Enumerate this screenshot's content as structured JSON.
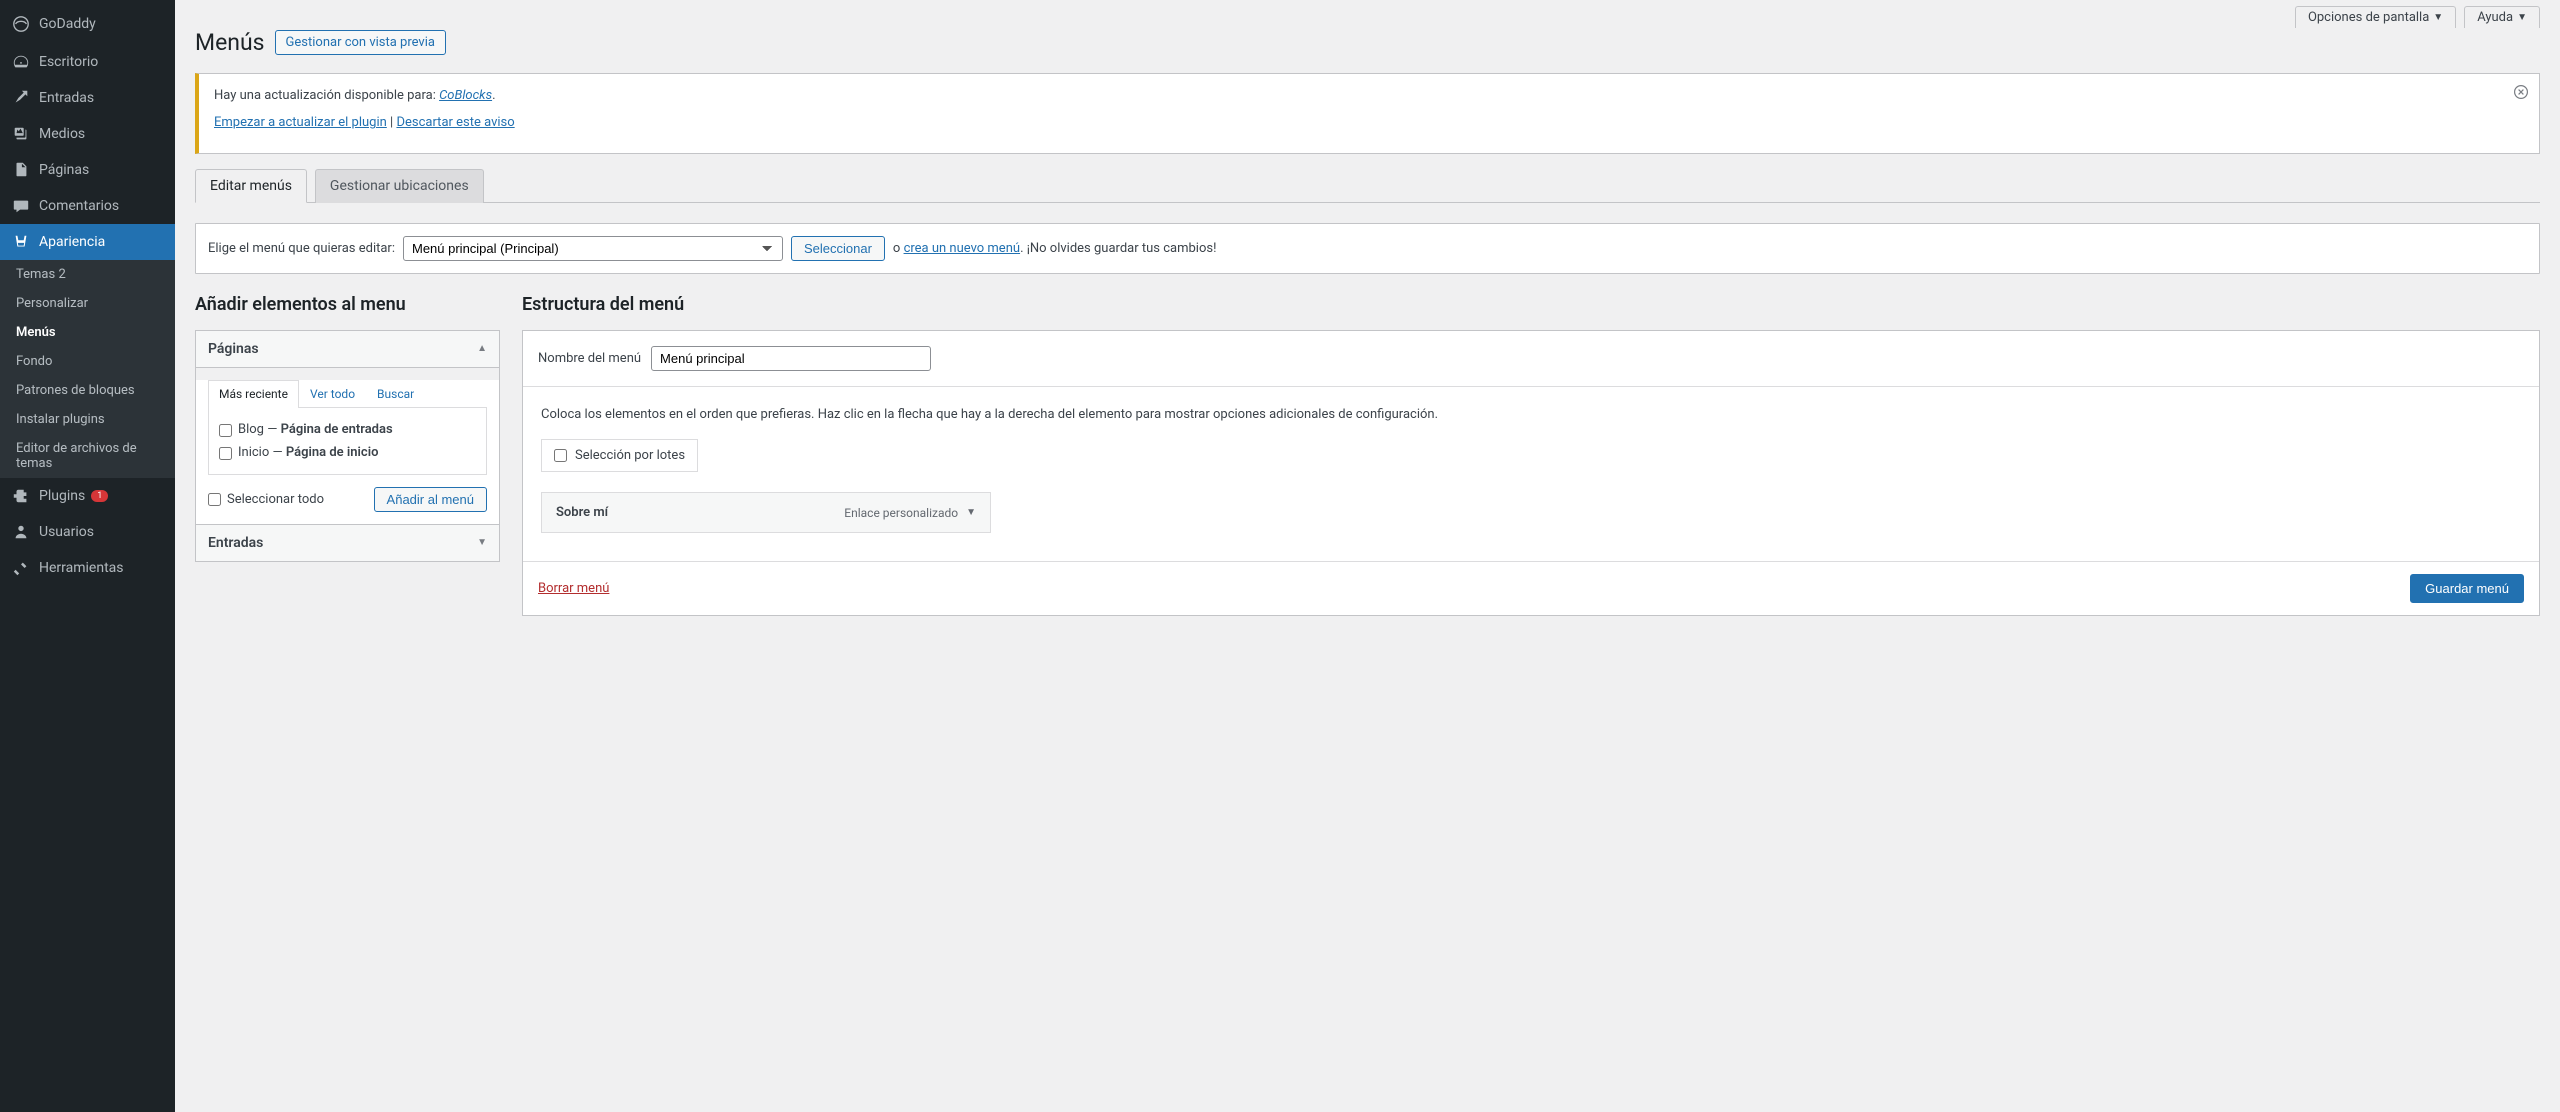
{
  "sidebar": {
    "brand": "GoDaddy",
    "items": [
      {
        "icon": "dashboard",
        "label": "Escritorio"
      },
      {
        "icon": "pin",
        "label": "Entradas"
      },
      {
        "icon": "media",
        "label": "Medios"
      },
      {
        "icon": "page",
        "label": "Páginas"
      },
      {
        "icon": "comment",
        "label": "Comentarios"
      },
      {
        "icon": "appearance",
        "label": "Apariencia",
        "active": true
      },
      {
        "icon": "plugin",
        "label": "Plugins",
        "badge": "1"
      },
      {
        "icon": "users",
        "label": "Usuarios"
      },
      {
        "icon": "tools",
        "label": "Herramientas"
      }
    ],
    "appearance_sub": [
      {
        "label": "Temas",
        "badge": "2"
      },
      {
        "label": "Personalizar"
      },
      {
        "label": "Menús",
        "active": true
      },
      {
        "label": "Fondo"
      },
      {
        "label": "Patrones de bloques"
      },
      {
        "label": "Instalar plugins"
      },
      {
        "label": "Editor de archivos de temas"
      }
    ]
  },
  "screen_opts": "Opciones de pantalla",
  "help": "Ayuda",
  "page_title": "Menús",
  "title_action": "Gestionar con vista previa",
  "notice": {
    "text_prefix": "Hay una actualización disponible para: ",
    "plugin": "CoBlocks",
    "punct": ".",
    "start_update": "Empezar a actualizar el plugin",
    "sep": " | ",
    "dismiss": "Descartar este aviso"
  },
  "tabs": {
    "edit": "Editar menús",
    "locations": "Gestionar ubicaciones"
  },
  "selector": {
    "label": "Elige el menú que quieras editar:",
    "selected": "Menú principal (Principal)",
    "select_btn": "Seleccionar",
    "or": "o ",
    "create": "crea un nuevo menú",
    "reminder": ". ¡No olvides guardar tus cambios!"
  },
  "left": {
    "heading": "Añadir elementos al menu",
    "pages_header": "Páginas",
    "inner_tabs": {
      "recent": "Más reciente",
      "all": "Ver todo",
      "search": "Buscar"
    },
    "page_items": [
      {
        "label_pre": "Blog — ",
        "label_bold": "Página de entradas"
      },
      {
        "label_pre": "Inicio — ",
        "label_bold": "Página de inicio"
      }
    ],
    "select_all": "Seleccionar todo",
    "add_btn": "Añadir al menú",
    "entries_header": "Entradas"
  },
  "right": {
    "heading": "Estructura del menú",
    "name_label": "Nombre del menú",
    "name_value": "Menú principal",
    "instructions": "Coloca los elementos en el orden que prefieras. Haz clic en la flecha que hay a la derecha del elemento para mostrar opciones adicionales de configuración.",
    "batch": "Selección por lotes",
    "items": [
      {
        "title": "Sobre mí",
        "type": "Enlace personalizado"
      }
    ],
    "delete": "Borrar menú",
    "save": "Guardar menú"
  }
}
